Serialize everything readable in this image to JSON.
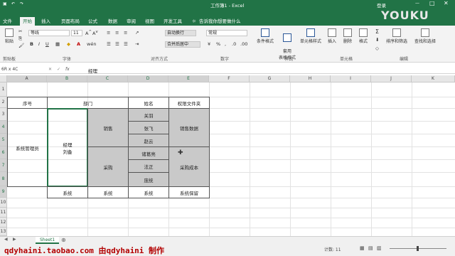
{
  "titlebar": {
    "doc_title": "工作簿1 - Excel",
    "login": "登录",
    "watermark": "YOUKU"
  },
  "tabs": {
    "items": [
      "文件",
      "开始",
      "插入",
      "页面布局",
      "公式",
      "数据",
      "审阅",
      "视图",
      "开发工具"
    ],
    "tellme": "告诉我你想要做什么"
  },
  "ribbon": {
    "font_name": "等线",
    "font_size": "11",
    "number_format": "常规",
    "paste": "粘贴",
    "cut": "剪切",
    "wrap_text": "自动换行",
    "merge_center": "合并后居中",
    "conditional_format": "条件格式",
    "format_table": "套用\n表格格式",
    "cell_styles": "单元格样式",
    "insert": "插入",
    "delete": "删除",
    "format": "格式",
    "sort_filter": "排序和筛选",
    "find_select": "查找和选择",
    "groups": {
      "clipboard": "剪贴板",
      "font": "字体",
      "alignment": "对齐方式",
      "number": "数字",
      "styles": "样式",
      "cells": "单元格",
      "editing": "编辑"
    }
  },
  "formula_bar": {
    "name_box": "6R x 4C",
    "fx": "fx",
    "content": "经理"
  },
  "columns": [
    "A",
    "B",
    "C",
    "D",
    "E",
    "F",
    "G",
    "H",
    "I",
    "J",
    "K"
  ],
  "rows": [
    "1",
    "2",
    "3",
    "4",
    "5",
    "6",
    "7",
    "8",
    "9",
    "10",
    "11",
    "12",
    "13"
  ],
  "table": {
    "header_seq": "序号",
    "header_dept": "部门",
    "header_name": "姓名",
    "header_perm": "权限文件夹",
    "admin": "系统管理员",
    "manager": "经理\n刘备",
    "dept_sales": "销售",
    "dept_purchase": "采购",
    "names_sales": [
      "关羽",
      "张飞",
      "赵云"
    ],
    "names_purchase": [
      "诸葛亮",
      "法正",
      "庞统"
    ],
    "perm_sales": "销售数据",
    "perm_purchase": "采购成本",
    "footer_b": "系统",
    "footer_c": "系统",
    "footer_d": "系统",
    "footer_e": "系统保留"
  },
  "bottom": {
    "sheet_tab": "Sheet1",
    "watermark": "qdyhaini.taobao.com 由qdyhaini 制作",
    "count": "计数: 11"
  }
}
